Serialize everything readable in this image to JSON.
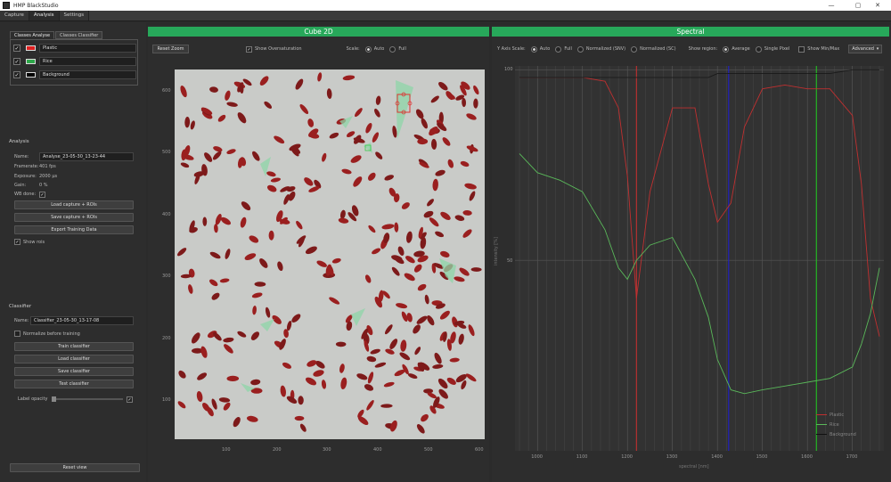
{
  "window": {
    "title": "HMP BlackStudio",
    "icons": [
      "minimize-icon",
      "maximize-icon",
      "close-icon"
    ]
  },
  "menu": {
    "tabs": [
      "Capture",
      "Analysis",
      "Settings"
    ],
    "active": 1
  },
  "left": {
    "subtabs": [
      "Classes Analyse",
      "Classes Classifier"
    ],
    "classes": [
      {
        "name": "Plastic",
        "color": "#e02020",
        "checked": "✓"
      },
      {
        "name": "Rice",
        "color": "#2ea84a",
        "checked": "✓"
      },
      {
        "name": "Background",
        "color": "#000000",
        "checked": "✓"
      }
    ],
    "analysis": {
      "title": "Analysis",
      "name_label": "Name:",
      "name_value": "Analyse_23-05-30_13-23-44",
      "framerate_label": "Framerate:",
      "framerate_value": "401 fps",
      "exposure_label": "Exposure:",
      "exposure_value": "2000 µs",
      "gain_label": "Gain:",
      "gain_value": "0 %",
      "wb_label": "WB done:",
      "wb_check": "✓",
      "load_btn": "Load capture + ROIs",
      "save_btn": "Save capture + ROIs",
      "export_btn": "Export Training Data",
      "show_rois": "Show rois",
      "show_rois_check": "✓"
    },
    "classifier": {
      "title": "Classifier",
      "name_label": "Name:",
      "name_value": "Classifier_23-05-30_13-17-08",
      "normalize": "Normalize before training",
      "train_btn": "Train classifier",
      "load_btn": "Load classifier",
      "save_btn": "Save classifier",
      "test_btn": "Test classifier",
      "opacity_label": "Label opacity",
      "opacity_check": "✓"
    },
    "reset_btn": "Reset view"
  },
  "cube": {
    "title": "Cube 2D",
    "reset_zoom": "Reset Zoom",
    "oversat_check": "✓",
    "oversat": "Show Oversaturation",
    "scale_label": "Scale:",
    "scale_opts": [
      "Auto",
      "Full"
    ],
    "yticks": [
      "600",
      "500",
      "400",
      "300",
      "200",
      "100"
    ],
    "xticks": [
      "100",
      "200",
      "300",
      "400",
      "500",
      "600"
    ]
  },
  "spectral": {
    "title": "Spectral",
    "yaxis_label": "Y Axis Scale:",
    "yaxis_opts": [
      "Auto",
      "Full",
      "Normalized (SNV)",
      "Normalized (SC)"
    ],
    "region_label": "Show region:",
    "region_opts": [
      "Average",
      "Single Pixel"
    ],
    "minmax": "Show Min/Max",
    "advanced": "Advanced",
    "xlabel": "spectral [nm]",
    "ylabel": "intensity [%]",
    "yticks": [
      "100",
      "50"
    ],
    "xticks": [
      "1000",
      "1100",
      "1200",
      "1300",
      "1400",
      "1500",
      "1600",
      "1700"
    ],
    "legend": [
      "Plastic",
      "Rice",
      "Background"
    ]
  },
  "chart_data": {
    "type": "line",
    "xlabel": "spectral [nm]",
    "ylabel": "intensity [%]",
    "xlim": [
      950,
      1770
    ],
    "ylim": [
      0,
      100
    ],
    "grid": true,
    "legend_position": "bottom-right",
    "x": [
      960,
      1000,
      1050,
      1100,
      1150,
      1180,
      1200,
      1220,
      1250,
      1300,
      1350,
      1380,
      1400,
      1430,
      1460,
      1500,
      1550,
      1600,
      1650,
      1700,
      1720,
      1740,
      1760
    ],
    "series": [
      {
        "name": "Plastic",
        "color": "#c03030",
        "values": [
          98,
          98,
          98,
          98,
          97,
          90,
          72,
          40,
          68,
          90,
          90,
          70,
          60,
          65,
          85,
          95,
          96,
          95,
          95,
          88,
          70,
          40,
          30
        ]
      },
      {
        "name": "Rice",
        "color": "#5ab85a",
        "values": [
          78,
          73,
          71,
          68,
          58,
          48,
          45,
          50,
          54,
          56,
          45,
          35,
          24,
          16,
          15,
          16,
          17,
          18,
          19,
          22,
          28,
          36,
          48
        ]
      },
      {
        "name": "Background",
        "color": "#1a1a1a",
        "values": [
          98,
          98,
          98,
          98,
          98,
          98,
          98,
          98,
          98,
          98,
          98,
          98,
          99,
          99,
          99,
          99,
          99,
          99,
          99,
          100,
          100,
          100,
          100
        ]
      }
    ],
    "vlines": [
      {
        "x": 1220,
        "color": "#c03030"
      },
      {
        "x": 1425,
        "color": "#1e1ecc"
      },
      {
        "x": 1620,
        "color": "#22c022"
      }
    ]
  }
}
